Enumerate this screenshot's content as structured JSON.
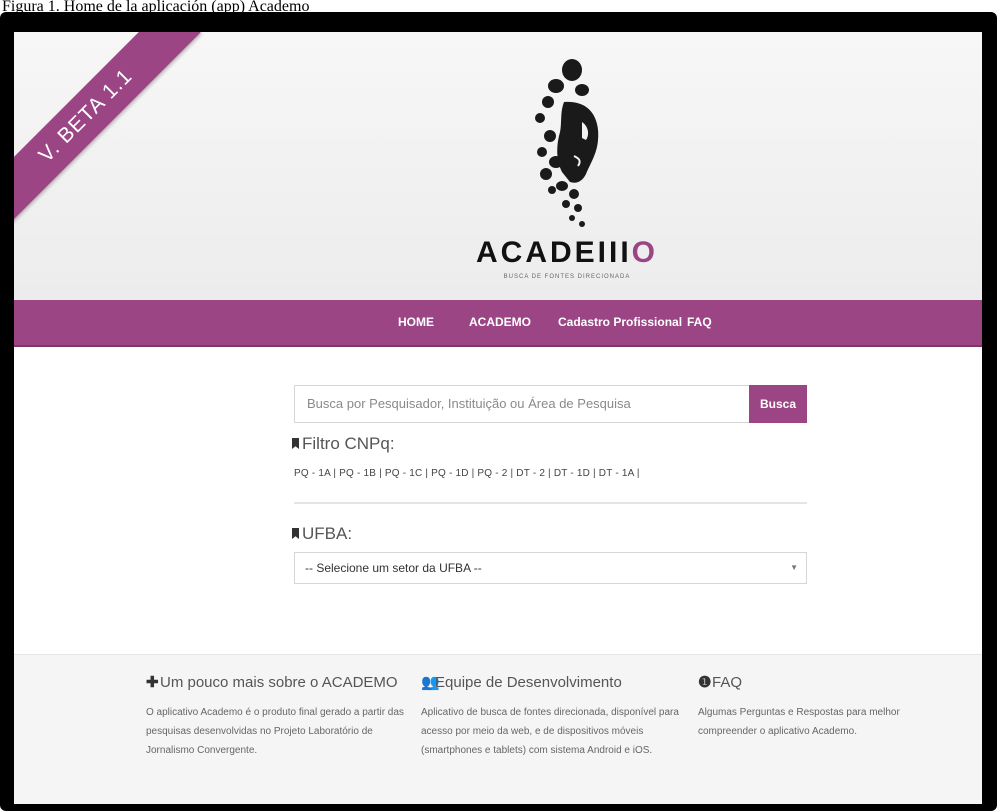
{
  "figure_caption": "Figura 1. Home de la aplicación (app) Academo",
  "ribbon": {
    "label": "V. BETA 1.1"
  },
  "brand": {
    "name_prefix": "ACADE",
    "name_mid": "III",
    "name_suffix": "O",
    "tagline": "BUSCA DE FONTES DIRECIONADA",
    "accent_color": "#9c4585"
  },
  "nav": {
    "home": "HOME",
    "academo": "ACADEMO",
    "cadastro": "Cadastro Profissional",
    "faq": "FAQ"
  },
  "search": {
    "placeholder": "Busca por Pesquisador, Instituição ou Área de Pesquisa",
    "button": "Busca"
  },
  "filter": {
    "title": "Filtro CNPq:",
    "links": "PQ - 1A | PQ - 1B | PQ - 1C | PQ - 1D | PQ - 2 | DT - 2 | DT - 1D | DT - 1A |"
  },
  "ufba": {
    "title": "UFBA:",
    "selected": "-- Selecione um setor da UFBA --"
  },
  "footer": {
    "about": {
      "icon": "plus-icon",
      "title": "Um pouco mais sobre o ACADEMO",
      "text": "O aplicativo Academo é o produto final gerado a partir das pesquisas desenvolvidas no Projeto Laboratório de Jornalismo Convergente."
    },
    "team": {
      "icon": "users-icon",
      "title": "Equipe de Desenvolvimento",
      "text": "Aplicativo de busca de fontes direcionada, disponível para acesso por meio da web, e de dispositivos móveis (smartphones e tablets) com sistema Android e iOS."
    },
    "faq": {
      "icon": "info-icon",
      "title": "FAQ",
      "text": "Algumas Perguntas e Respostas para melhor compreender o aplicativo Academo."
    }
  }
}
